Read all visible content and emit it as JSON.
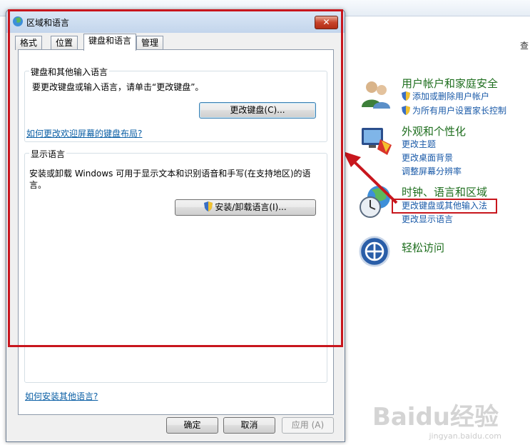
{
  "dialog": {
    "title": "区域和语言",
    "close_label": "✕",
    "tabs": [
      "格式",
      "位置",
      "键盘和语言",
      "管理"
    ],
    "keyboard_group": {
      "label": "键盘和其他输入语言",
      "description": "要更改键盘或输入语言，请单击“更改键盘”。",
      "change_keyboard_button": "更改键盘(C)...",
      "welcome_link": "如何更改欢迎屏幕的键盘布局?"
    },
    "display_group": {
      "label": "显示语言",
      "description_line1": "安装或卸载 Windows 可用于显示文本和识别语音和手写(在支持地区)的语",
      "description_line2": "言。",
      "install_button": "安装/卸载语言(I)..."
    },
    "install_other_link": "如何安装其他语言?",
    "buttons": {
      "ok": "确定",
      "cancel": "取消",
      "apply": "应用 (A)"
    }
  },
  "control_panel": {
    "categories": [
      {
        "title": "用户帐户和家庭安全",
        "links": [
          "添加或删除用户帐户",
          "为所有用户设置家长控制"
        ]
      },
      {
        "title": "外观和个性化",
        "links": [
          "更改主题",
          "更改桌面背景",
          "调整屏幕分辨率"
        ]
      },
      {
        "title": "时钟、语言和区域",
        "links": [
          "更改键盘或其他输入法",
          "更改显示语言"
        ]
      },
      {
        "title": "轻松访问",
        "links": []
      }
    ],
    "right_edge_text": "查"
  },
  "watermark": {
    "logo": "Baidu经验",
    "url": "jingyan.baidu.com"
  },
  "colors": {
    "highlight_red": "#c8161d",
    "category_green": "#1e6e1e",
    "link_blue": "#1a5aa8"
  }
}
